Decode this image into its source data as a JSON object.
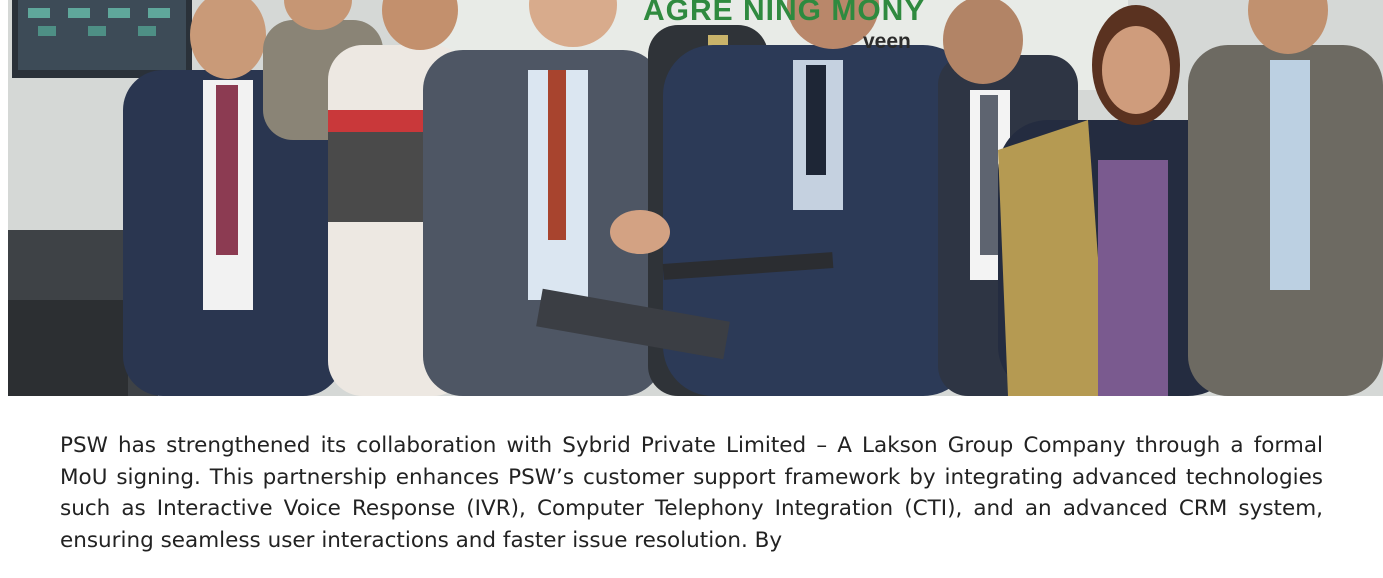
{
  "photo": {
    "banner_line1": "AGRE     NING       MONY",
    "banner_line2": "veen"
  },
  "article": {
    "paragraph": "PSW has strengthened its collaboration with Sybrid Private Limited – A Lakson Group Company through a formal MoU signing. This partnership enhances PSW’s customer support framework by integrating advanced technologies such as Interactive Voice Response (IVR), Computer Telephony Integration (CTI), and an advanced CRM system, ensuring seamless user interactions and faster issue resolution. By"
  },
  "colors": {
    "banner_green": "#2f8a3f",
    "text": "#222222",
    "suit_navy": "#2c3a57"
  }
}
